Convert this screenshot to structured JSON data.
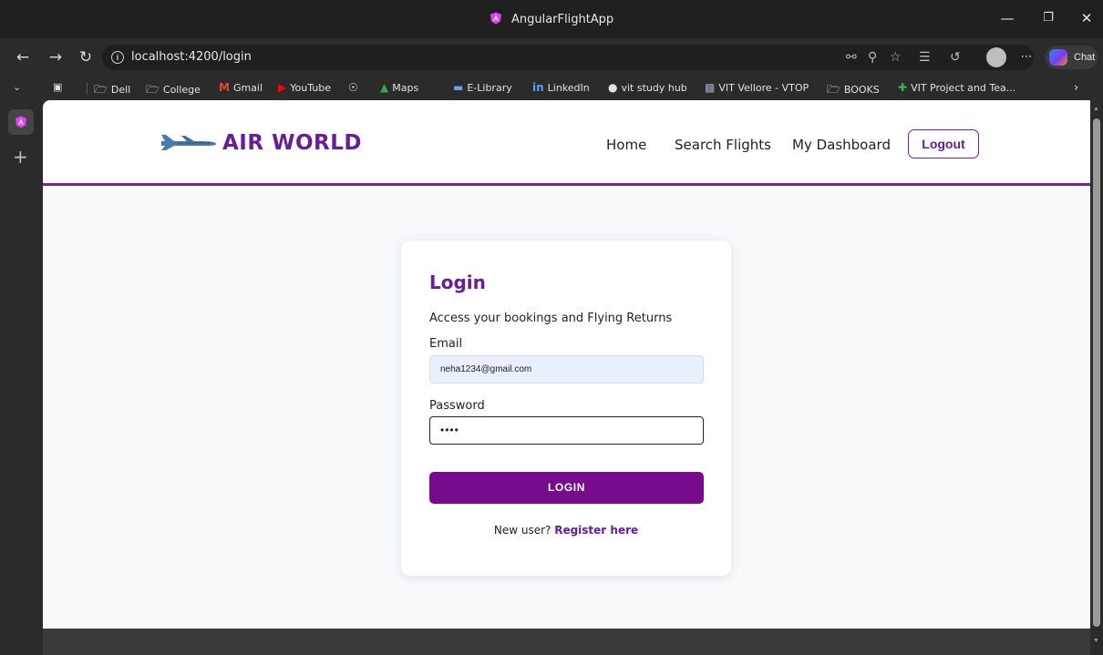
{
  "browser": {
    "window_title": "AngularFlightApp",
    "url": "localhost:4200/login",
    "chat_label": "Chat",
    "bookmarks": [
      {
        "label": "",
        "icon": "reading-list-icon"
      },
      {
        "label": "Dell",
        "icon": "folder-icon"
      },
      {
        "label": "College",
        "icon": "folder-icon"
      },
      {
        "label": "Gmail",
        "icon": "gmail-icon"
      },
      {
        "label": "YouTube",
        "icon": "youtube-icon"
      },
      {
        "label": "",
        "icon": "globe-icon"
      },
      {
        "label": "Maps",
        "icon": "maps-icon"
      },
      {
        "label": "E-Library",
        "icon": "library-icon"
      },
      {
        "label": "LinkedIn",
        "icon": "linkedin-icon"
      },
      {
        "label": "vit study hub",
        "icon": "study-hub-icon"
      },
      {
        "label": "VIT Vellore - VTOP",
        "icon": "vtop-icon"
      },
      {
        "label": "BOOKS",
        "icon": "folder-icon"
      },
      {
        "label": "VIT Project and Tea...",
        "icon": "project-icon"
      }
    ]
  },
  "app": {
    "brand": "AIR WORLD",
    "nav": [
      {
        "label": "Home"
      },
      {
        "label": "Search Flights"
      },
      {
        "label": "My Dashboard"
      }
    ],
    "logout_label": "Logout",
    "colors": {
      "accent": "#6a1b9a",
      "button": "#760b8c",
      "header_border": "#7b1fa2"
    }
  },
  "login": {
    "title": "Login",
    "subtitle": "Access your bookings and Flying Returns",
    "email_label": "Email",
    "email_value": "neha1234@gmail.com",
    "password_label": "Password",
    "password_value": "••••",
    "submit_label": "LOGIN",
    "register_prompt": "New user?",
    "register_link": "Register here"
  }
}
